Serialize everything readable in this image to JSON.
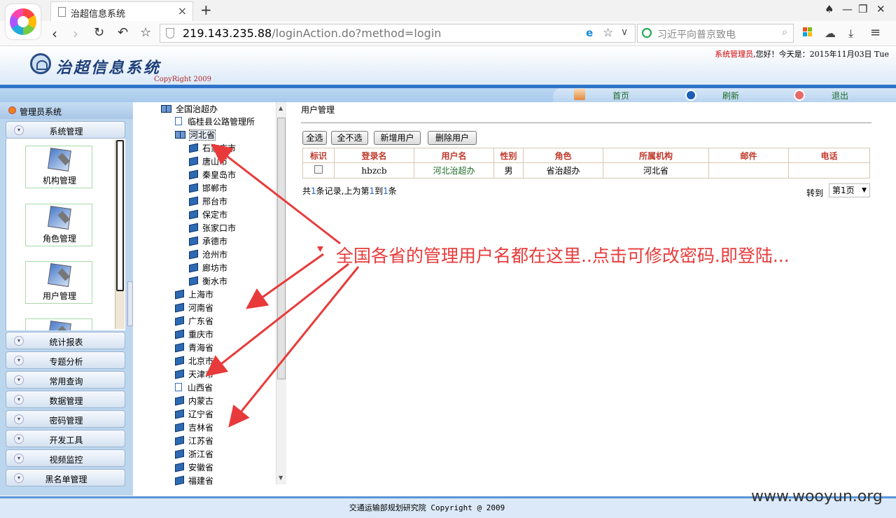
{
  "browser": {
    "tab_title": "治超信息系统",
    "url_host": "219.143.235.88",
    "url_path": "/loginAction.do?method=login",
    "search_placeholder": "习近平向普京致电"
  },
  "site": {
    "title": "治超信息系统",
    "copyright": "CopyRight 2009",
    "greeting_user": "系统管理员",
    "greeting_rest": ",您好！今天是：2015年11月03日 Tue"
  },
  "top_menu": {
    "home": "首页",
    "refresh": "刷新",
    "logout": "退出"
  },
  "left_panel": {
    "title": "管理员系统",
    "open_section": "系统管理",
    "modules": [
      "机构管理",
      "角色管理",
      "用户管理"
    ],
    "sections": [
      "统计报表",
      "专题分析",
      "常用查询",
      "数据管理",
      "密码管理",
      "开发工具",
      "视频监控",
      "黑名单管理"
    ]
  },
  "tree": {
    "root": "全国治超办",
    "first_child": "临桂县公路管理所",
    "selected": "河北省",
    "hebei_cities": [
      "石家庄市",
      "唐山市",
      "秦皇岛市",
      "邯郸市",
      "邢台市",
      "保定市",
      "张家口市",
      "承德市",
      "沧州市",
      "廊坊市",
      "衡水市"
    ],
    "provinces": [
      {
        "label": "上海市",
        "icon": "book-icon"
      },
      {
        "label": "河南省",
        "icon": "book-icon"
      },
      {
        "label": "广东省",
        "icon": "book-icon"
      },
      {
        "label": "重庆市",
        "icon": "book-icon"
      },
      {
        "label": "青海省",
        "icon": "book-icon"
      },
      {
        "label": "北京市",
        "icon": "book-icon"
      },
      {
        "label": "天津市",
        "icon": "book-icon"
      },
      {
        "label": "山西省",
        "icon": "page-icon"
      },
      {
        "label": "内蒙古",
        "icon": "book-icon"
      },
      {
        "label": "辽宁省",
        "icon": "book-icon"
      },
      {
        "label": "吉林省",
        "icon": "book-icon"
      },
      {
        "label": "江苏省",
        "icon": "book-icon"
      },
      {
        "label": "浙江省",
        "icon": "book-icon"
      },
      {
        "label": "安徽省",
        "icon": "book-icon"
      },
      {
        "label": "福建省",
        "icon": "book-icon"
      }
    ]
  },
  "content": {
    "title": "用户管理",
    "buttons": {
      "select_all": "全选",
      "select_none": "全不选",
      "add_user": "新增用户",
      "delete_user": "删除用户"
    },
    "columns": [
      "标识",
      "登录名",
      "用户名",
      "性别",
      "角色",
      "所属机构",
      "邮件",
      "电话"
    ],
    "rows": [
      {
        "login": "hbzcb",
        "name": "河北治超办",
        "gender": "男",
        "role": "省治超办",
        "org": "河北省",
        "email": "",
        "phone": ""
      }
    ],
    "summary_prefix": "共",
    "summary_total": "1",
    "summary_mid1": "条记录,上为第",
    "summary_from": "1",
    "summary_mid2": "到",
    "summary_to": "1",
    "summary_suffix": "条",
    "goto_label": "转到",
    "page_selected": "第1页"
  },
  "annotation": "全国各省的管理用户名都在这里..点击可修改密码.即登陆...",
  "footer": "交通运输部规划研究院 Copyright @ 2009",
  "watermark": "www.wooyun.org",
  "colors": {
    "annotation": "#e83a3a",
    "table_header": "#c0392b",
    "brand_blue": "#2f73c9"
  }
}
